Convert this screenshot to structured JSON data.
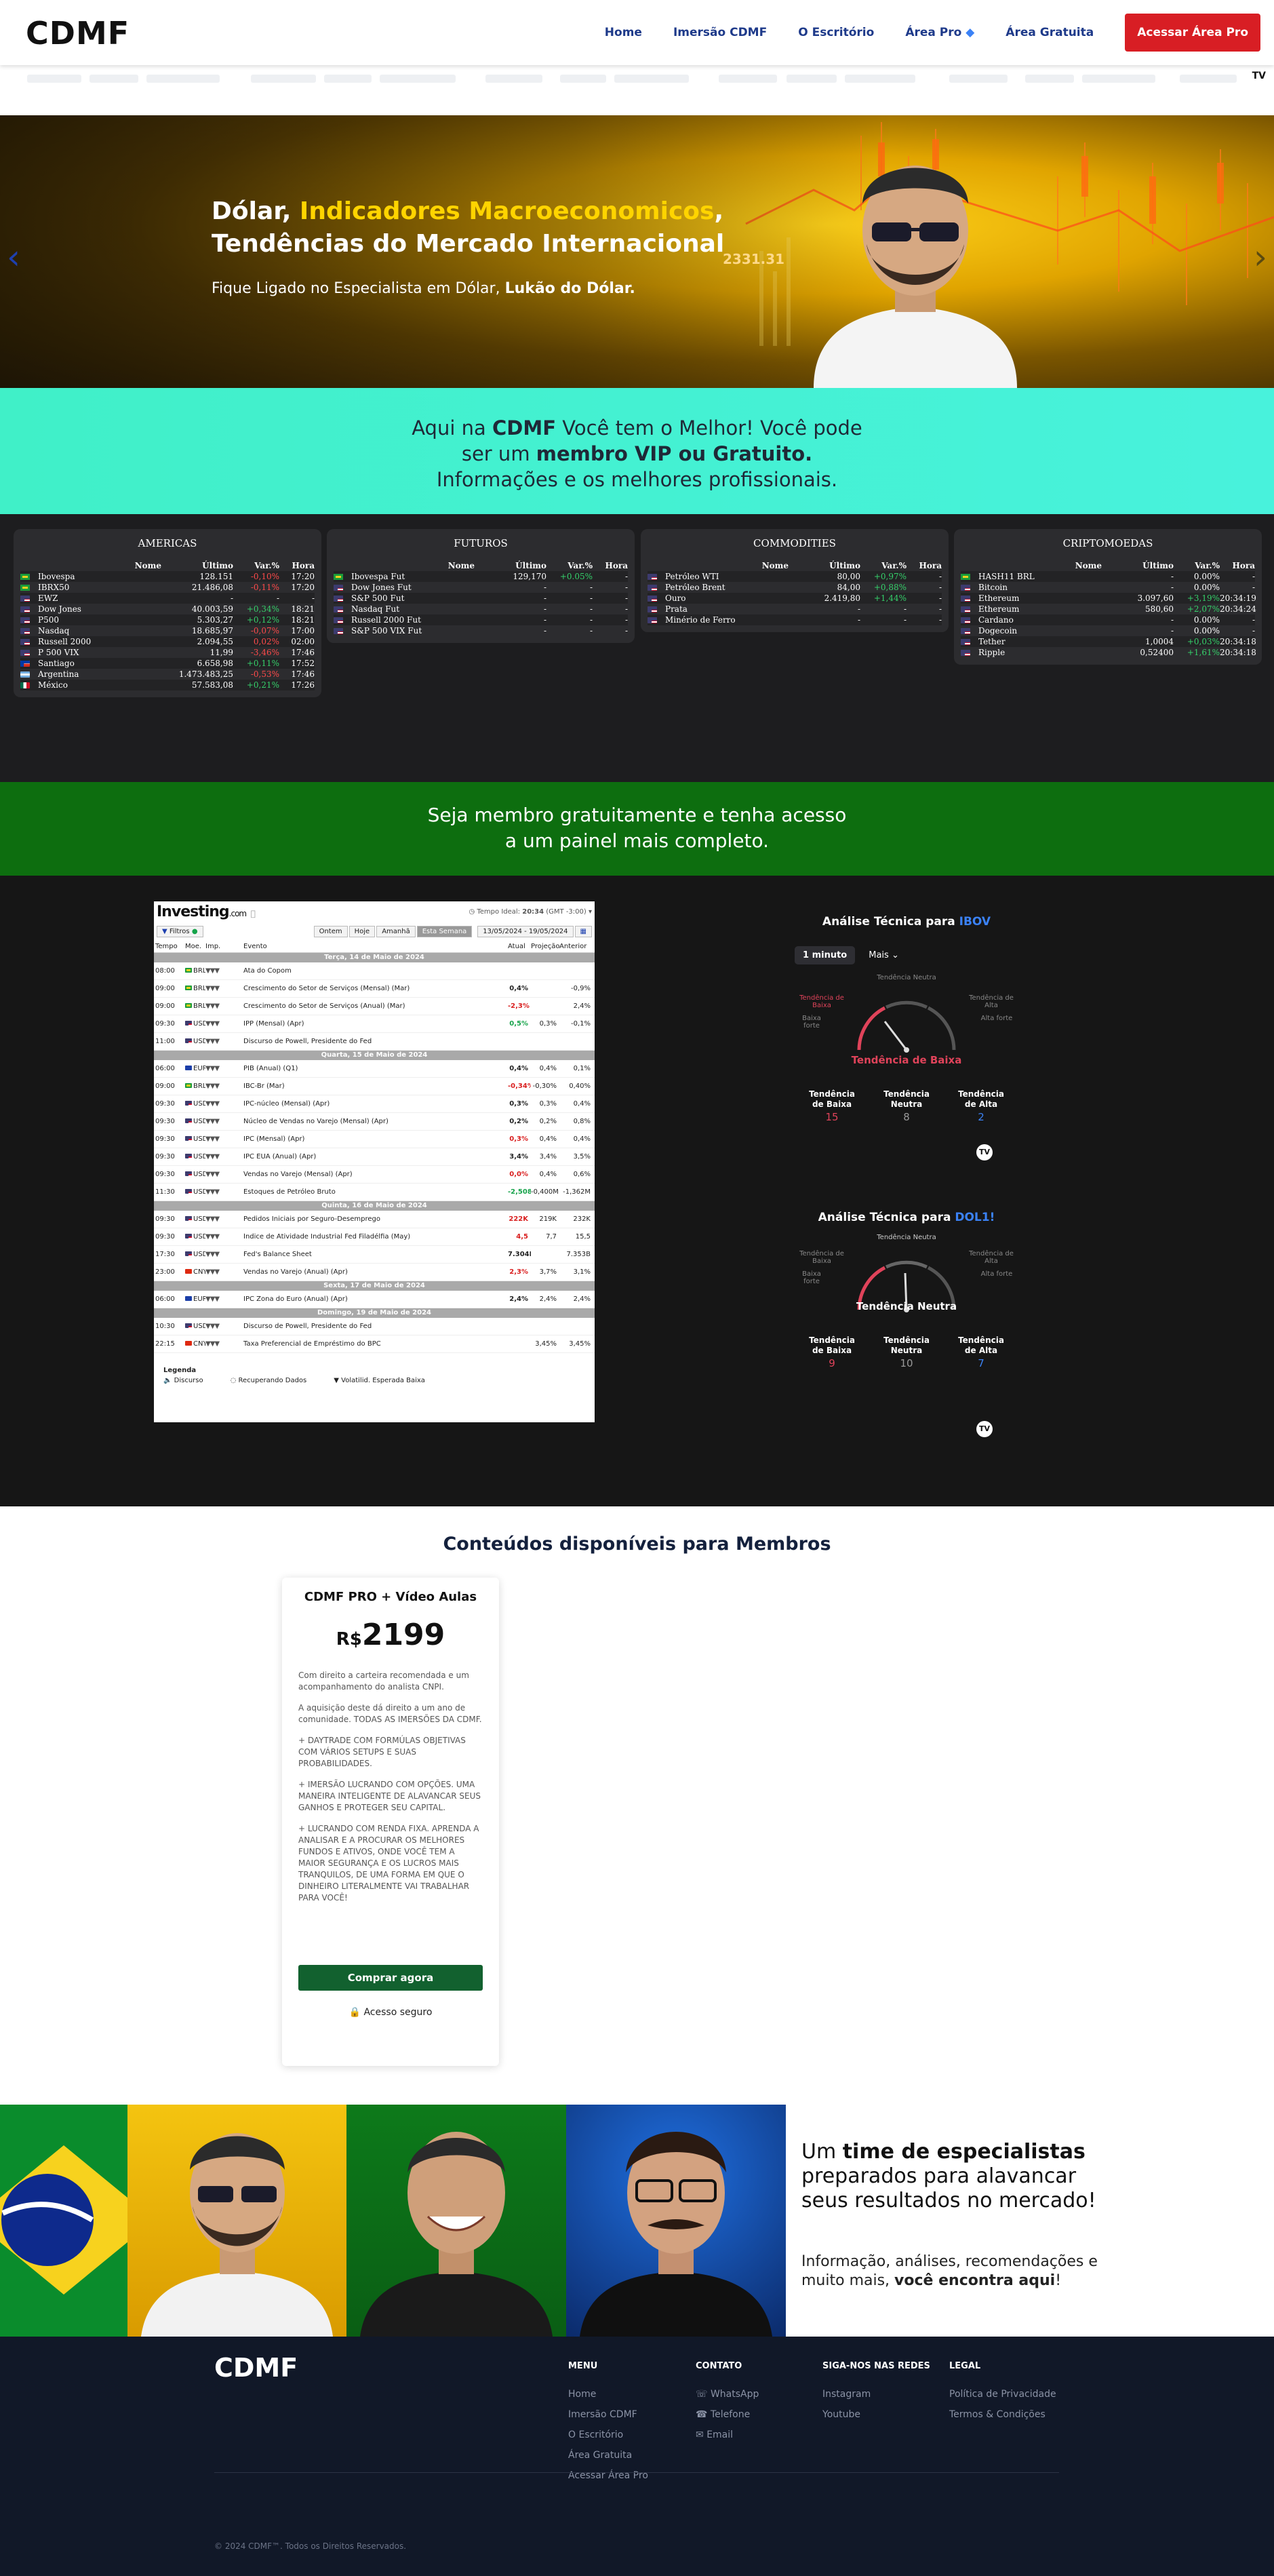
{
  "nav": {
    "logo": "CDMF",
    "links": [
      "Home",
      "Imersão CDMF",
      "O Escritório",
      "Área Pro",
      "Área Gratuita"
    ],
    "cta": "Acessar Área Pro"
  },
  "hero": {
    "title_part1": "Dólar, ",
    "title_highlight": "Indicadores Macroeconomicos",
    "title_part2": ",",
    "title_line2": "Tendências do Mercado Internacional",
    "subtitle_prefix": "Fique Ligado no Especialista em Dólar, ",
    "subtitle_bold": "Lukão do Dólar.",
    "price_tag": "2331.31"
  },
  "cyan_band": {
    "p1": "Aqui na ",
    "b1": "CDMF",
    "p2": " Você tem o Melhor! Você pode ser um ",
    "b2": "membro VIP ou Gratuito.",
    "p3": " Informações e os melhores profissionais."
  },
  "quotes": {
    "headers": [
      "Nome",
      "Último",
      "Var.%",
      "Hora"
    ],
    "panels": [
      {
        "title": "AMERICAS",
        "rows": [
          {
            "flag": "br",
            "name": "Ibovespa",
            "last": "128.151",
            "var": "-0,10%",
            "time": "17:20",
            "dir": "neg"
          },
          {
            "flag": "br",
            "name": "IBRX50",
            "last": "21.486,08",
            "var": "-0,11%",
            "time": "17:20",
            "dir": "neg"
          },
          {
            "flag": "us",
            "name": "EWZ",
            "last": "-",
            "var": "-",
            "time": "-",
            "dir": "none"
          },
          {
            "flag": "us",
            "name": "Dow Jones",
            "last": "40.003,59",
            "var": "+0,34%",
            "time": "18:21",
            "dir": "pos"
          },
          {
            "flag": "us",
            "name": "P500",
            "last": "5.303,27",
            "var": "+0,12%",
            "time": "18:21",
            "dir": "pos"
          },
          {
            "flag": "us",
            "name": "Nasdaq",
            "last": "18.685,97",
            "var": "-0,07%",
            "time": "17:00",
            "dir": "neg"
          },
          {
            "flag": "us",
            "name": "Russell 2000",
            "last": "2.094,55",
            "var": "0,02%",
            "time": "02:00",
            "dir": "neg"
          },
          {
            "flag": "us",
            "name": "P 500 VIX",
            "last": "11,99",
            "var": "-3,46%",
            "time": "17:46",
            "dir": "neg"
          },
          {
            "flag": "cl",
            "name": "Santiago",
            "last": "6.658,98",
            "var": "+0,11%",
            "time": "17:52",
            "dir": "pos"
          },
          {
            "flag": "ar",
            "name": "Argentina",
            "last": "1.473.483,25",
            "var": "-0,53%",
            "time": "17:46",
            "dir": "neg"
          },
          {
            "flag": "mx",
            "name": "México",
            "last": "57.583,08",
            "var": "+0,21%",
            "time": "17:26",
            "dir": "pos"
          }
        ]
      },
      {
        "title": "FUTUROS",
        "rows": [
          {
            "flag": "br",
            "name": "Ibovespa Fut",
            "last": "129,170",
            "var": "+0.05%",
            "time": "-",
            "dir": "pos"
          },
          {
            "flag": "us",
            "name": "Dow Jones Fut",
            "last": "-",
            "var": "-",
            "time": "-",
            "dir": "none"
          },
          {
            "flag": "us",
            "name": "S&P 500 Fut",
            "last": "-",
            "var": "-",
            "time": "-",
            "dir": "none"
          },
          {
            "flag": "us",
            "name": "Nasdaq Fut",
            "last": "-",
            "var": "-",
            "time": "-",
            "dir": "none"
          },
          {
            "flag": "us",
            "name": "Russell 2000 Fut",
            "last": "-",
            "var": "-",
            "time": "-",
            "dir": "none"
          },
          {
            "flag": "us",
            "name": "S&P 500 VIX Fut",
            "last": "-",
            "var": "-",
            "time": "-",
            "dir": "none"
          }
        ]
      },
      {
        "title": "COMMODITIES",
        "rows": [
          {
            "flag": "us",
            "name": "Petróleo WTI",
            "last": "80,00",
            "var": "+0,97%",
            "time": "-",
            "dir": "pos"
          },
          {
            "flag": "us",
            "name": "Petróleo Brent",
            "last": "84,00",
            "var": "+0,88%",
            "time": "-",
            "dir": "pos"
          },
          {
            "flag": "us",
            "name": "Ouro",
            "last": "2.419,80",
            "var": "+1,44%",
            "time": "-",
            "dir": "pos"
          },
          {
            "flag": "us",
            "name": "Prata",
            "last": "-",
            "var": "-",
            "time": "-",
            "dir": "none"
          },
          {
            "flag": "us",
            "name": "Minério de Ferro",
            "last": "-",
            "var": "-",
            "time": "-",
            "dir": "none"
          }
        ]
      },
      {
        "title": "CRIPTOMOEDAS",
        "rows": [
          {
            "flag": "br",
            "name": "HASH11 BRL",
            "last": "-",
            "var": "0.00%",
            "time": "-",
            "dir": "none"
          },
          {
            "flag": "us",
            "name": "Bitcoin",
            "last": "-",
            "var": "0.00%",
            "time": "-",
            "dir": "none"
          },
          {
            "flag": "us",
            "name": "Ethereum",
            "last": "3.097,60",
            "var": "+3,19%",
            "time": "20:34:19",
            "dir": "pos"
          },
          {
            "flag": "us",
            "name": "Ethereum",
            "last": "580,60",
            "var": "+2,07%",
            "time": "20:34:24",
            "dir": "pos"
          },
          {
            "flag": "us",
            "name": "Cardano",
            "last": "-",
            "var": "0.00%",
            "time": "-",
            "dir": "none"
          },
          {
            "flag": "us",
            "name": "Dogecoin",
            "last": "-",
            "var": "0.00%",
            "time": "-",
            "dir": "none"
          },
          {
            "flag": "us",
            "name": "Tether",
            "last": "1,0004",
            "var": "+0,03%",
            "time": "20:34:18",
            "dir": "pos"
          },
          {
            "flag": "us",
            "name": "Ripple",
            "last": "0,52400",
            "var": "+1,61%",
            "time": "20:34:18",
            "dir": "pos"
          }
        ]
      }
    ]
  },
  "green_band": {
    "line1": "Seja membro gratuitamente e tenha acesso",
    "line2": "a um painel mais completo."
  },
  "calendar": {
    "logo": "Investing",
    "logo_suffix": ".com",
    "time_label": "Tempo Ideal: ",
    "time_value": "20:34",
    "time_zone": " (GMT -3:00)",
    "filter": "Filtros",
    "buttons": [
      "Ontem",
      "Hoje",
      "Amanhã",
      "Esta Semana"
    ],
    "date_range": "13/05/2024 - 19/05/2024",
    "columns": [
      "Tempo",
      "Moe.",
      "Imp.",
      "Evento",
      "Atual",
      "Projeção",
      "Anterior"
    ],
    "days": [
      {
        "label": "Terça, 14 de Maio de 2024",
        "rows": [
          {
            "time": "08:00",
            "cur": "BRL",
            "event": "Ata do Copom",
            "actual": "",
            "proj": "",
            "prev": "",
            "adir": ""
          },
          {
            "time": "09:00",
            "cur": "BRL",
            "event": "Crescimento do Setor de Serviços (Mensal) (Mar)",
            "actual": "0,4%",
            "proj": "",
            "prev": "-0,9%",
            "adir": ""
          },
          {
            "time": "09:00",
            "cur": "BRL",
            "event": "Crescimento do Setor de Serviços (Anual) (Mar)",
            "actual": "-2,3%",
            "proj": "",
            "prev": "2,4%",
            "adir": "neg"
          },
          {
            "time": "09:30",
            "cur": "USD",
            "event": "IPP (Mensal) (Apr)",
            "actual": "0,5%",
            "proj": "0,3%",
            "prev": "-0,1%",
            "adir": "pos"
          },
          {
            "time": "11:00",
            "cur": "USD",
            "event": "Discurso de Powell, Presidente do Fed",
            "actual": "",
            "proj": "",
            "prev": "",
            "adir": ""
          }
        ]
      },
      {
        "label": "Quarta, 15 de Maio de 2024",
        "rows": [
          {
            "time": "06:00",
            "cur": "EUR",
            "event": "PIB (Anual) (Q1)",
            "actual": "0,4%",
            "proj": "0,4%",
            "prev": "0,1%",
            "adir": ""
          },
          {
            "time": "09:00",
            "cur": "BRL",
            "event": "IBC-Br (Mar)",
            "actual": "-0,34%",
            "proj": "-0,30%",
            "prev": "0,40%",
            "adir": "neg"
          },
          {
            "time": "09:30",
            "cur": "USD",
            "event": "IPC-núcleo (Mensal) (Apr)",
            "actual": "0,3%",
            "proj": "0,3%",
            "prev": "0,4%",
            "adir": ""
          },
          {
            "time": "09:30",
            "cur": "USD",
            "event": "Núcleo de Vendas no Varejo (Mensal) (Apr)",
            "actual": "0,2%",
            "proj": "0,2%",
            "prev": "0,8%",
            "adir": ""
          },
          {
            "time": "09:30",
            "cur": "USD",
            "event": "IPC (Mensal) (Apr)",
            "actual": "0,3%",
            "proj": "0,4%",
            "prev": "0,4%",
            "adir": "neg"
          },
          {
            "time": "09:30",
            "cur": "USD",
            "event": "IPC EUA (Anual) (Apr)",
            "actual": "3,4%",
            "proj": "3,4%",
            "prev": "3,5%",
            "adir": ""
          },
          {
            "time": "09:30",
            "cur": "USD",
            "event": "Vendas no Varejo (Mensal) (Apr)",
            "actual": "0,0%",
            "proj": "0,4%",
            "prev": "0,6%",
            "adir": "neg"
          },
          {
            "time": "11:30",
            "cur": "USD",
            "event": "Estoques de Petróleo Bruto",
            "actual": "-2,508M",
            "proj": "-0,400M",
            "prev": "-1,362M",
            "adir": "pos"
          }
        ]
      },
      {
        "label": "Quinta, 16 de Maio de 2024",
        "rows": [
          {
            "time": "09:30",
            "cur": "USD",
            "event": "Pedidos Iniciais por Seguro-Desemprego",
            "actual": "222K",
            "proj": "219K",
            "prev": "232K",
            "adir": "neg"
          },
          {
            "time": "09:30",
            "cur": "USD",
            "event": "Índice de Atividade Industrial Fed Filadélfia (May)",
            "actual": "4,5",
            "proj": "7,7",
            "prev": "15,5",
            "adir": "neg"
          },
          {
            "time": "17:30",
            "cur": "USD",
            "event": "Fed's Balance Sheet",
            "actual": "7.304B",
            "proj": "",
            "prev": "7.353B",
            "adir": ""
          },
          {
            "time": "23:00",
            "cur": "CNY",
            "event": "Vendas no Varejo (Anual) (Apr)",
            "actual": "2,3%",
            "proj": "3,7%",
            "prev": "3,1%",
            "adir": "neg"
          }
        ]
      },
      {
        "label": "Sexta, 17 de Maio de 2024",
        "rows": [
          {
            "time": "06:00",
            "cur": "EUR",
            "event": "IPC Zona do Euro (Anual) (Apr)",
            "actual": "2,4%",
            "proj": "2,4%",
            "prev": "2,4%",
            "adir": ""
          }
        ]
      },
      {
        "label": "Domingo, 19 de Maio de 2024",
        "rows": [
          {
            "time": "10:30",
            "cur": "USD",
            "event": "Discurso de Powell, Presidente do Fed",
            "actual": "",
            "proj": "",
            "prev": "",
            "adir": ""
          },
          {
            "time": "22:15",
            "cur": "CNY",
            "event": "Taxa Preferencial de Empréstimo do BPC",
            "actual": "",
            "proj": "3,45%",
            "prev": "3,45%",
            "adir": ""
          }
        ]
      }
    ],
    "legend_title": "Legenda",
    "legend_items": [
      "Discurso",
      "Recuperando Dados",
      "Volatilid. Esperada Baixa"
    ]
  },
  "tech1": {
    "title_prefix": "Análise Técnica para ",
    "symbol": "IBOV",
    "tab_active": "1 minuto",
    "tab_more": "Mais",
    "labels": {
      "neutral": "Tendência Neutra",
      "sell": "Tendência de Baixa",
      "strong_sell": "Baixa forte",
      "buy": "Tendência de Alta",
      "strong_buy": "Alta forte"
    },
    "verdict": "Tendência de Baixa",
    "counts": [
      {
        "label": "Tendência de Baixa",
        "value": "15"
      },
      {
        "label": "Tendência Neutra",
        "value": "8"
      },
      {
        "label": "Tendência de Alta",
        "value": "2"
      }
    ]
  },
  "tech2": {
    "title_prefix": "Análise Técnica para ",
    "symbol": "DOL1!",
    "labels": {
      "neutral": "Tendência Neutra",
      "sell": "Tendência de Baixa",
      "strong_sell": "Baixa forte",
      "buy": "Tendência de Alta",
      "strong_buy": "Alta forte"
    },
    "verdict": "Tendência Neutra",
    "counts": [
      {
        "label": "Tendência de Baixa",
        "value": "9"
      },
      {
        "label": "Tendência Neutra",
        "value": "10"
      },
      {
        "label": "Tendência de Alta",
        "value": "7"
      }
    ]
  },
  "content": {
    "title": "Conteúdos disponíveis para Membros",
    "card_title": "CDMF PRO + Vídeo Aulas",
    "currency": "R$",
    "price": "2199",
    "paragraphs": [
      "Com direito a carteira recomendada e um acompanhamento do analista CNPI.",
      "A aquisição deste dá direito a um ano de comunidade. TODAS AS IMERSÕES DA CDMF.",
      "+ DAYTRADE COM FORMÚLAS OBJETIVAS COM VÁRIOS SETUPS E SUAS PROBABILIDADES.",
      "+ IMERSÃO LUCRANDO COM OPÇÕES. UMA MANEIRA INTELIGENTE DE ALAVANCAR SEUS GANHOS E PROTEGER SEU CAPITAL.",
      "+ LUCRANDO COM RENDA FIXA. APRENDA A ANALISAR E A PROCURAR OS MELHORES FUNDOS E ATIVOS, ONDE VOCÊ TEM A MAIOR SEGURANÇA E OS LUCROS MAIS TRANQUILOS, DE UMA FORMA EM QUE O DINHEIRO LITERALMENTE VAI TRABALHAR PARA VOCÊ!"
    ],
    "buy_button": "Comprar agora",
    "secure": "Acesso seguro"
  },
  "team": {
    "p1": "Um ",
    "b1": "time de especialistas",
    "p2": " preparados para alavancar seus resultados no mercado!",
    "sub_p": "Informação, análises, recomendações e muito mais, ",
    "sub_b": "você encontra aqui",
    "sub_end": "!"
  },
  "footer": {
    "logo": "CDMF",
    "menu_title": "MENU",
    "menu": [
      "Home",
      "Imersão CDMF",
      "O Escritório",
      "Área Gratuita",
      "Acessar Área Pro"
    ],
    "contact_title": "CONTATO",
    "contact": [
      "WhatsApp",
      "Telefone",
      "Email"
    ],
    "social_title": "SIGA-NOS NAS REDES",
    "social": [
      "Instagram",
      "Youtube"
    ],
    "legal_title": "LEGAL",
    "legal": [
      "Política de Privacidade",
      "Termos & Condições"
    ],
    "copyright": "© 2024 CDMF™. Todos os Direitos Reservados."
  },
  "colors": {
    "accent_blue": "#1e3a8a",
    "cta_red": "#d81e24",
    "hero_yellow": "#ffd400",
    "cyan_band": "#44f0d2",
    "green_band": "#0d6e0f",
    "positive": "#35d06a",
    "negative": "#ff4a4a",
    "buy_green": "#12612f",
    "footer_bg": "#111828"
  }
}
